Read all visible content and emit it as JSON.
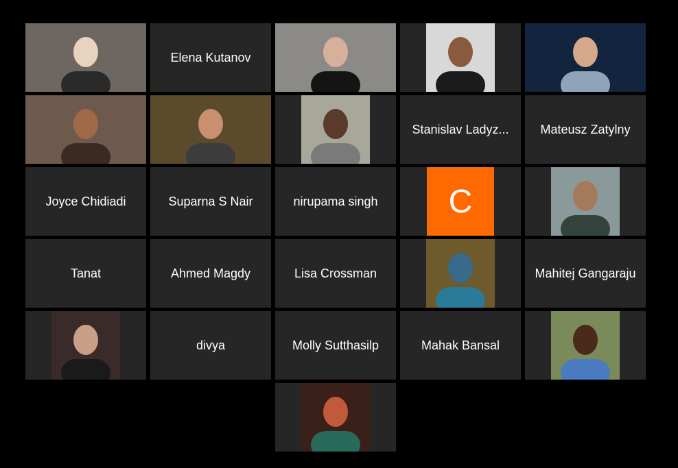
{
  "gallery": {
    "tiles": [
      {
        "kind": "video",
        "active": true,
        "bg": "#6e6660",
        "fg": "#e8d3c0",
        "shirt": "#2a2a2a",
        "label": "",
        "photo": "full"
      },
      {
        "kind": "name",
        "label": "Elena Kutanov"
      },
      {
        "kind": "video",
        "bg": "#8c8a86",
        "fg": "#d6b09a",
        "shirt": "#141414",
        "label": "",
        "photo": "full"
      },
      {
        "kind": "video",
        "bg": "#d8d8d8",
        "fg": "#8a5a3c",
        "shirt": "#1b1b1b",
        "label": "",
        "photo": "narrow"
      },
      {
        "kind": "video",
        "bg": "#12243e",
        "fg": "#d4a888",
        "shirt": "#8fa4b8",
        "label": "",
        "photo": "full"
      },
      {
        "kind": "video",
        "bg": "#6e5a4c",
        "fg": "#a06a48",
        "shirt": "#3a2a22",
        "label": "",
        "photo": "full"
      },
      {
        "kind": "video",
        "bg": "#5c4a2c",
        "fg": "#c89070",
        "shirt": "#3c3c3c",
        "label": "",
        "photo": "full"
      },
      {
        "kind": "video",
        "bg": "#a8a89a",
        "fg": "#5a3a28",
        "shirt": "#7a7a7a",
        "label": "",
        "photo": "narrow"
      },
      {
        "kind": "name",
        "label": "Stanislav Ladyz..."
      },
      {
        "kind": "name",
        "label": "Mateusz Zatylny"
      },
      {
        "kind": "name",
        "label": "Joyce Chidiadi"
      },
      {
        "kind": "name",
        "label": "Suparna S Nair"
      },
      {
        "kind": "name",
        "label": "nirupama singh"
      },
      {
        "kind": "letter",
        "label": "C"
      },
      {
        "kind": "video",
        "bg": "#8a9a9a",
        "fg": "#a47a5c",
        "shirt": "#34443c",
        "label": "",
        "photo": "narrow"
      },
      {
        "kind": "name",
        "label": "Tanat"
      },
      {
        "kind": "name",
        "label": "Ahmed Magdy"
      },
      {
        "kind": "name",
        "label": "Lisa Crossman"
      },
      {
        "kind": "video",
        "bg": "#6e5a2a",
        "fg": "#3a6a8a",
        "shirt": "#2a7a9a",
        "label": "",
        "photo": "narrow"
      },
      {
        "kind": "name",
        "label": "Mahitej Gangaraju"
      },
      {
        "kind": "video",
        "bg": "#3a2a2a",
        "fg": "#c8a088",
        "shirt": "#1a1a1a",
        "label": "",
        "photo": "narrow"
      },
      {
        "kind": "name",
        "label": "divya"
      },
      {
        "kind": "name",
        "label": "Molly Sutthasilp"
      },
      {
        "kind": "name",
        "label": "Mahak Bansal"
      },
      {
        "kind": "video",
        "bg": "#7a8a5a",
        "fg": "#4a2a1a",
        "shirt": "#4a7ac0",
        "label": "",
        "photo": "narrow"
      },
      {
        "kind": "video",
        "bg": "#3a2018",
        "fg": "#c05a3a",
        "shirt": "#2a6a5a",
        "label": "",
        "photo": "narrow"
      }
    ]
  }
}
